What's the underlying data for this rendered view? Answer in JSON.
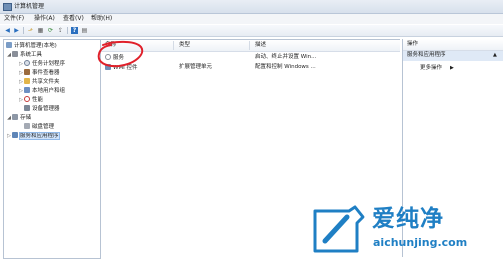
{
  "window": {
    "title": "计算机管理",
    "icon": "computer-management-icon"
  },
  "menubar": {
    "items": [
      "文件(F)",
      "操作(A)",
      "查看(V)",
      "帮助(H)"
    ]
  },
  "toolbar": {
    "buttons": [
      {
        "name": "back-button",
        "icon": "back-arrow-icon",
        "glyph": "◀"
      },
      {
        "name": "forward-button",
        "icon": "forward-arrow-icon",
        "glyph": "▶"
      },
      {
        "name": "up-button",
        "icon": "folder-up-icon",
        "glyph": "⬏"
      },
      {
        "name": "show-hide-tree-button",
        "icon": "tree-icon",
        "glyph": "▦"
      },
      {
        "name": "refresh-button",
        "icon": "refresh-icon",
        "glyph": "⟳"
      },
      {
        "name": "export-button",
        "icon": "export-icon",
        "glyph": "⇪"
      },
      {
        "name": "help-button",
        "icon": "help-icon",
        "glyph": "?"
      },
      {
        "name": "properties-button",
        "icon": "properties-icon",
        "glyph": "▤"
      }
    ]
  },
  "tree": {
    "root": "计算机管理(本地)",
    "system_tools": "系统工具",
    "task_scheduler": "任务计划程序",
    "event_viewer": "事件查看器",
    "shared_folders": "共享文件夹",
    "local_users": "本地用户和组",
    "performance": "性能",
    "device_manager": "设备管理器",
    "storage": "存储",
    "disk_management": "磁盘管理",
    "services_apps": "服务和应用程序"
  },
  "list": {
    "columns": {
      "name": "名称",
      "type": "类型",
      "description": "描述"
    },
    "rows": [
      {
        "name": "服务",
        "type": "",
        "description": "启动、终止并设置 Win..."
      },
      {
        "name": "WMI 控件",
        "type": "扩展管理单元",
        "description": "配置和控制 Windows ..."
      }
    ]
  },
  "actions": {
    "header": "操作",
    "group": "服务和应用程序",
    "more": "更多操作"
  },
  "watermark": {
    "brand": "爱纯净",
    "url": "aichunjing.com"
  },
  "colors": {
    "annotation_red": "#e0202a",
    "watermark_blue": "#1f7fc4",
    "selection": "#cfe3fb"
  }
}
